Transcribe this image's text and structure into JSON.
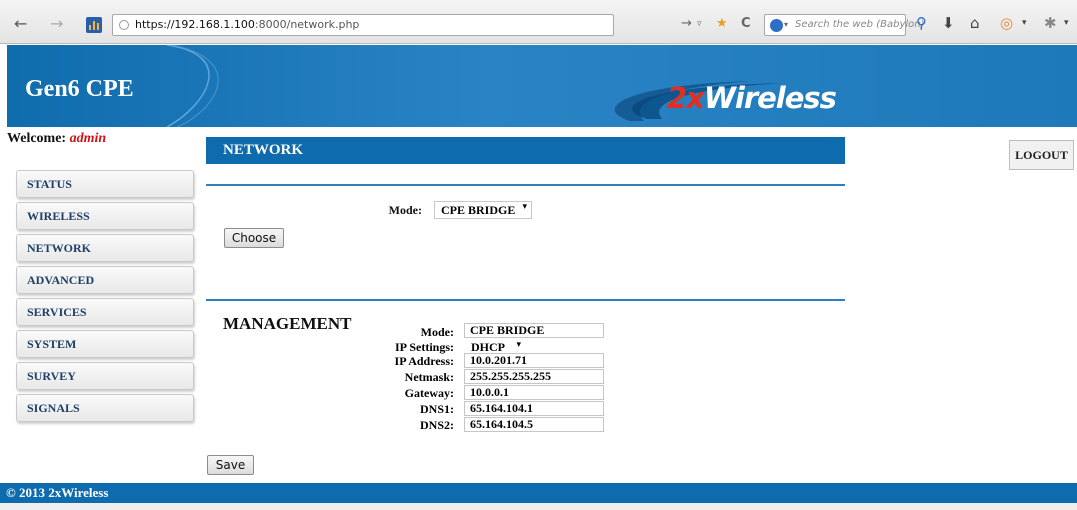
{
  "browser": {
    "url_host": "https://192.168.1.100",
    "url_rest": ":8000/network.php",
    "search_placeholder": "Search the web (Babylon)"
  },
  "header": {
    "brand": "Gen6 CPE",
    "logo_prefix": "2x",
    "logo_suffix": "Wireless"
  },
  "welcome": {
    "label": "Welcome:",
    "user": "admin"
  },
  "logout_label": "LOGOUT",
  "sidebar": {
    "items": [
      {
        "label": "STATUS"
      },
      {
        "label": "WIRELESS"
      },
      {
        "label": "NETWORK"
      },
      {
        "label": "ADVANCED"
      },
      {
        "label": "SERVICES"
      },
      {
        "label": "SYSTEM"
      },
      {
        "label": "SURVEY"
      },
      {
        "label": "SIGNALS"
      }
    ]
  },
  "network": {
    "title": "NETWORK",
    "mode_label": "Mode:",
    "mode_value": "CPE BRIDGE",
    "choose_label": "Choose"
  },
  "management": {
    "title": "MANAGEMENT",
    "fields": [
      {
        "label": "Mode:",
        "value": "CPE BRIDGE"
      },
      {
        "label": "IP Settings:",
        "value": "DHCP"
      },
      {
        "label": "IP Address:",
        "value": "10.0.201.71"
      },
      {
        "label": "Netmask:",
        "value": "255.255.255.255"
      },
      {
        "label": "Gateway:",
        "value": "10.0.0.1"
      },
      {
        "label": "DNS1:",
        "value": "65.164.104.1"
      },
      {
        "label": "DNS2:",
        "value": "65.164.104.5"
      }
    ],
    "save_label": "Save"
  },
  "footer": {
    "text": "© 2013 2xWireless"
  },
  "colors": {
    "brand_blue": "#0e6cae",
    "accent_red": "#c8141b"
  }
}
